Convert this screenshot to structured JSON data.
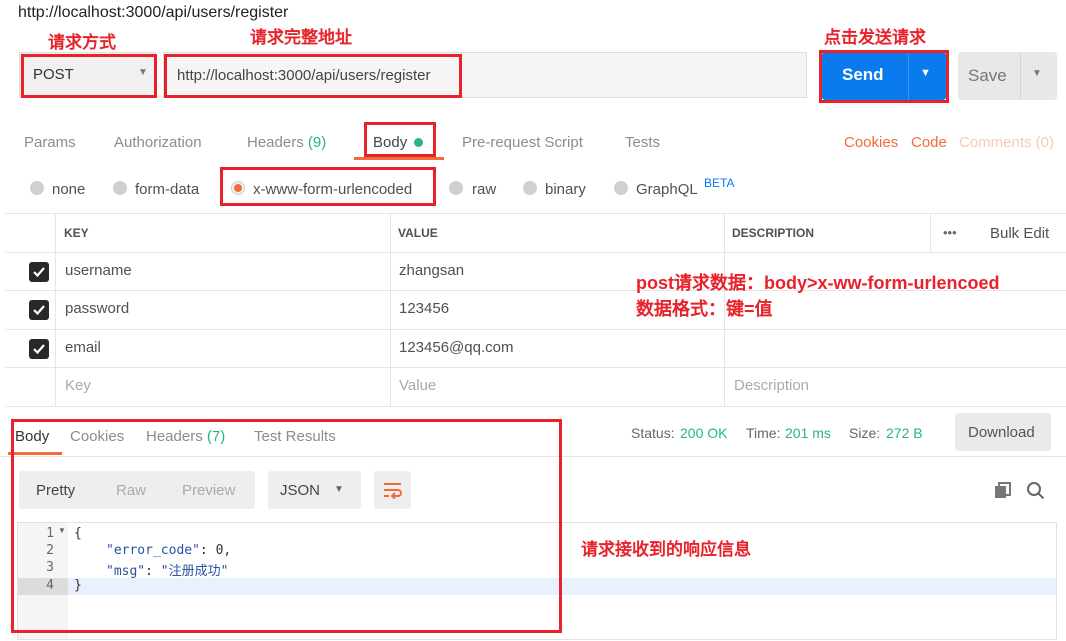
{
  "window": {
    "url_title": "http://localhost:3000/api/users/register"
  },
  "request": {
    "method": "POST",
    "url": "http://localhost:3000/api/users/register",
    "send_label": "Send",
    "save_label": "Save"
  },
  "annotations": {
    "method": "请求方式",
    "url": "请求完整地址",
    "send": "点击发送请求",
    "post_data_line1": "post请求数据：body>x-ww-form-urlencoed",
    "post_data_line2": "数据格式：键=值",
    "response": "请求接收到的响应信息"
  },
  "request_tabs": {
    "params": "Params",
    "authorization": "Authorization",
    "headers": "Headers",
    "headers_count": "(9)",
    "body": "Body",
    "prerequest": "Pre-request Script",
    "tests": "Tests",
    "cookies": "Cookies",
    "code": "Code",
    "comments": "Comments (0)"
  },
  "body_types": {
    "none": "none",
    "form_data": "form-data",
    "urlencoded": "x-www-form-urlencoded",
    "raw": "raw",
    "binary": "binary",
    "graphql": "GraphQL",
    "beta": "BETA",
    "selected": "x-www-form-urlencoded"
  },
  "params_table": {
    "headers": {
      "key": "KEY",
      "value": "VALUE",
      "description": "DESCRIPTION",
      "more": "•••",
      "bulk_edit": "Bulk Edit"
    },
    "rows": [
      {
        "checked": true,
        "key": "username",
        "value": "zhangsan",
        "description": ""
      },
      {
        "checked": true,
        "key": "password",
        "value": "123456",
        "description": ""
      },
      {
        "checked": true,
        "key": "email",
        "value": "123456@qq.com",
        "description": ""
      }
    ],
    "placeholder": {
      "key": "Key",
      "value": "Value",
      "description": "Description"
    }
  },
  "response": {
    "tabs": {
      "body": "Body",
      "cookies": "Cookies",
      "headers": "Headers",
      "headers_count": "(7)",
      "test_results": "Test Results"
    },
    "status_label": "Status:",
    "status_value": "200 OK",
    "time_label": "Time:",
    "time_value": "201 ms",
    "size_label": "Size:",
    "size_value": "272 B",
    "download_label": "Download",
    "view_modes": {
      "pretty": "Pretty",
      "raw": "Raw",
      "preview": "Preview"
    },
    "format": "JSON",
    "code_lines": [
      {
        "num": "1",
        "text": "{"
      },
      {
        "num": "2",
        "key": "\"error_code\"",
        "sep": ": ",
        "val": "0,"
      },
      {
        "num": "3",
        "key": "\"msg\"",
        "sep": ": ",
        "val": "\"注册成功\""
      },
      {
        "num": "4",
        "text": "}"
      }
    ]
  },
  "colors": {
    "accent_blue": "#097bed",
    "annotation_red": "#e8222a",
    "orange": "#f26b3a",
    "green": "#26b47f"
  }
}
